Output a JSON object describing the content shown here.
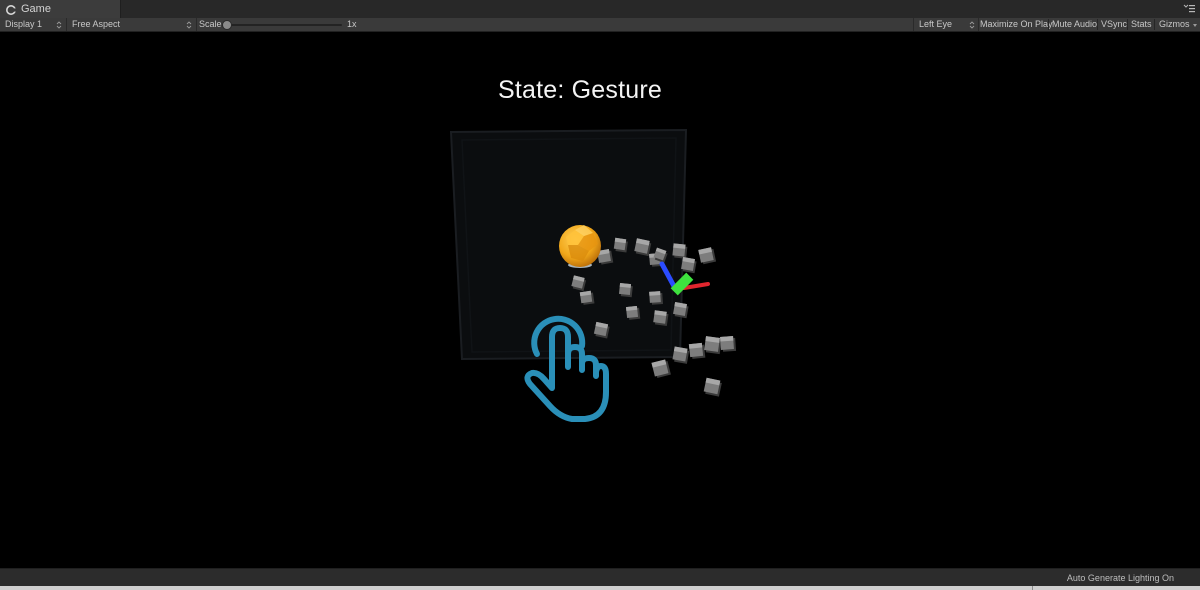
{
  "window": {
    "tab_title": "Game",
    "tab_icon": "unity-game-icon",
    "menu_icon": "tab-menu-icon"
  },
  "toolbar": {
    "display": "Display 1",
    "aspect": "Free Aspect",
    "scale_label": "Scale",
    "scale_value": "1x",
    "scale_level": 0.0,
    "eye": "Left Eye",
    "maximize": "Maximize On Play",
    "mute": "Mute Audio",
    "vsync": "VSync",
    "stats": "Stats",
    "gizmos": "Gizmos"
  },
  "viewport": {
    "state_text": "State: Gesture"
  },
  "status": {
    "text": "Auto Generate Lighting On"
  },
  "colors": {
    "hand_icon": "#2a8fb8",
    "orb": "#f2a81a",
    "axis_x": "#e0262e",
    "axis_y": "#3ee23e",
    "axis_z": "#2b4cff"
  }
}
